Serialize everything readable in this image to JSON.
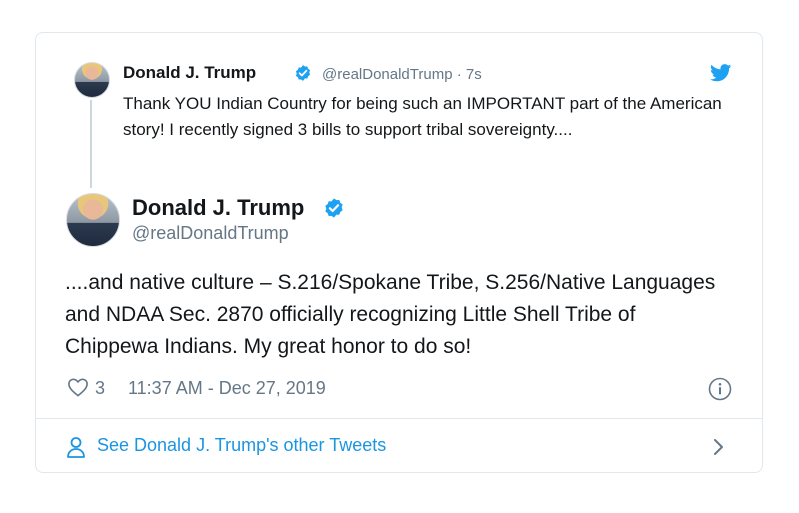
{
  "quoted_tweet": {
    "author_name": "Donald J. Trump",
    "handle": "@realDonaldTrump",
    "age": "· 7s",
    "text": "Thank YOU Indian Country for being such an IMPORTANT part of the American story! I recently signed 3 bills to support tribal sovereignty...."
  },
  "main_tweet": {
    "author_name": "Donald J. Trump",
    "handle": "@realDonaldTrump",
    "text": "....and native culture – S.216/Spokane Tribe, S.256/Native Languages and NDAA Sec. 2870 officially recognizing Little Shell Tribe of Chippewa Indians. My great honor to do so!",
    "likes": "3",
    "timestamp": "11:37 AM - Dec 27, 2019"
  },
  "footer": {
    "see_more_label": "See Donald J. Trump's other Tweets"
  },
  "icons": {
    "verified": "verified-badge-icon",
    "bird": "twitter-bird-icon",
    "heart": "heart-icon",
    "info": "info-icon",
    "person": "person-icon",
    "chevron": "chevron-right-icon"
  },
  "colors": {
    "accent": "#1b95e0",
    "verified": "#1da1f2",
    "muted": "#657786",
    "text": "#14171a",
    "border": "#e1e8ed"
  }
}
